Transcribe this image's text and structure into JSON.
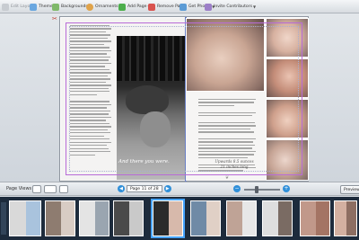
{
  "toolbar": {
    "items": [
      {
        "label": "Edit Layout"
      },
      {
        "label": "Themes"
      },
      {
        "label": "Backgrounds"
      },
      {
        "label": "Ornaments"
      },
      {
        "label": "Add Page"
      },
      {
        "label": "Remove Page"
      },
      {
        "label": "Get Photos"
      },
      {
        "label": "Invite Contributors"
      }
    ]
  },
  "left_page": {
    "caption": "And there you were."
  },
  "right_page": {
    "quote_line1": "Upwards 8.5 ounces",
    "quote_line2": "21 inches long"
  },
  "page_views": {
    "label": "Page Views",
    "page_indicator": "Page 11 of 28",
    "preview_label": "Preview"
  },
  "colors": {
    "accent": "#2f8fd9",
    "guide": "#b86bd8",
    "filmstrip_bg": "#1d2b3c"
  }
}
